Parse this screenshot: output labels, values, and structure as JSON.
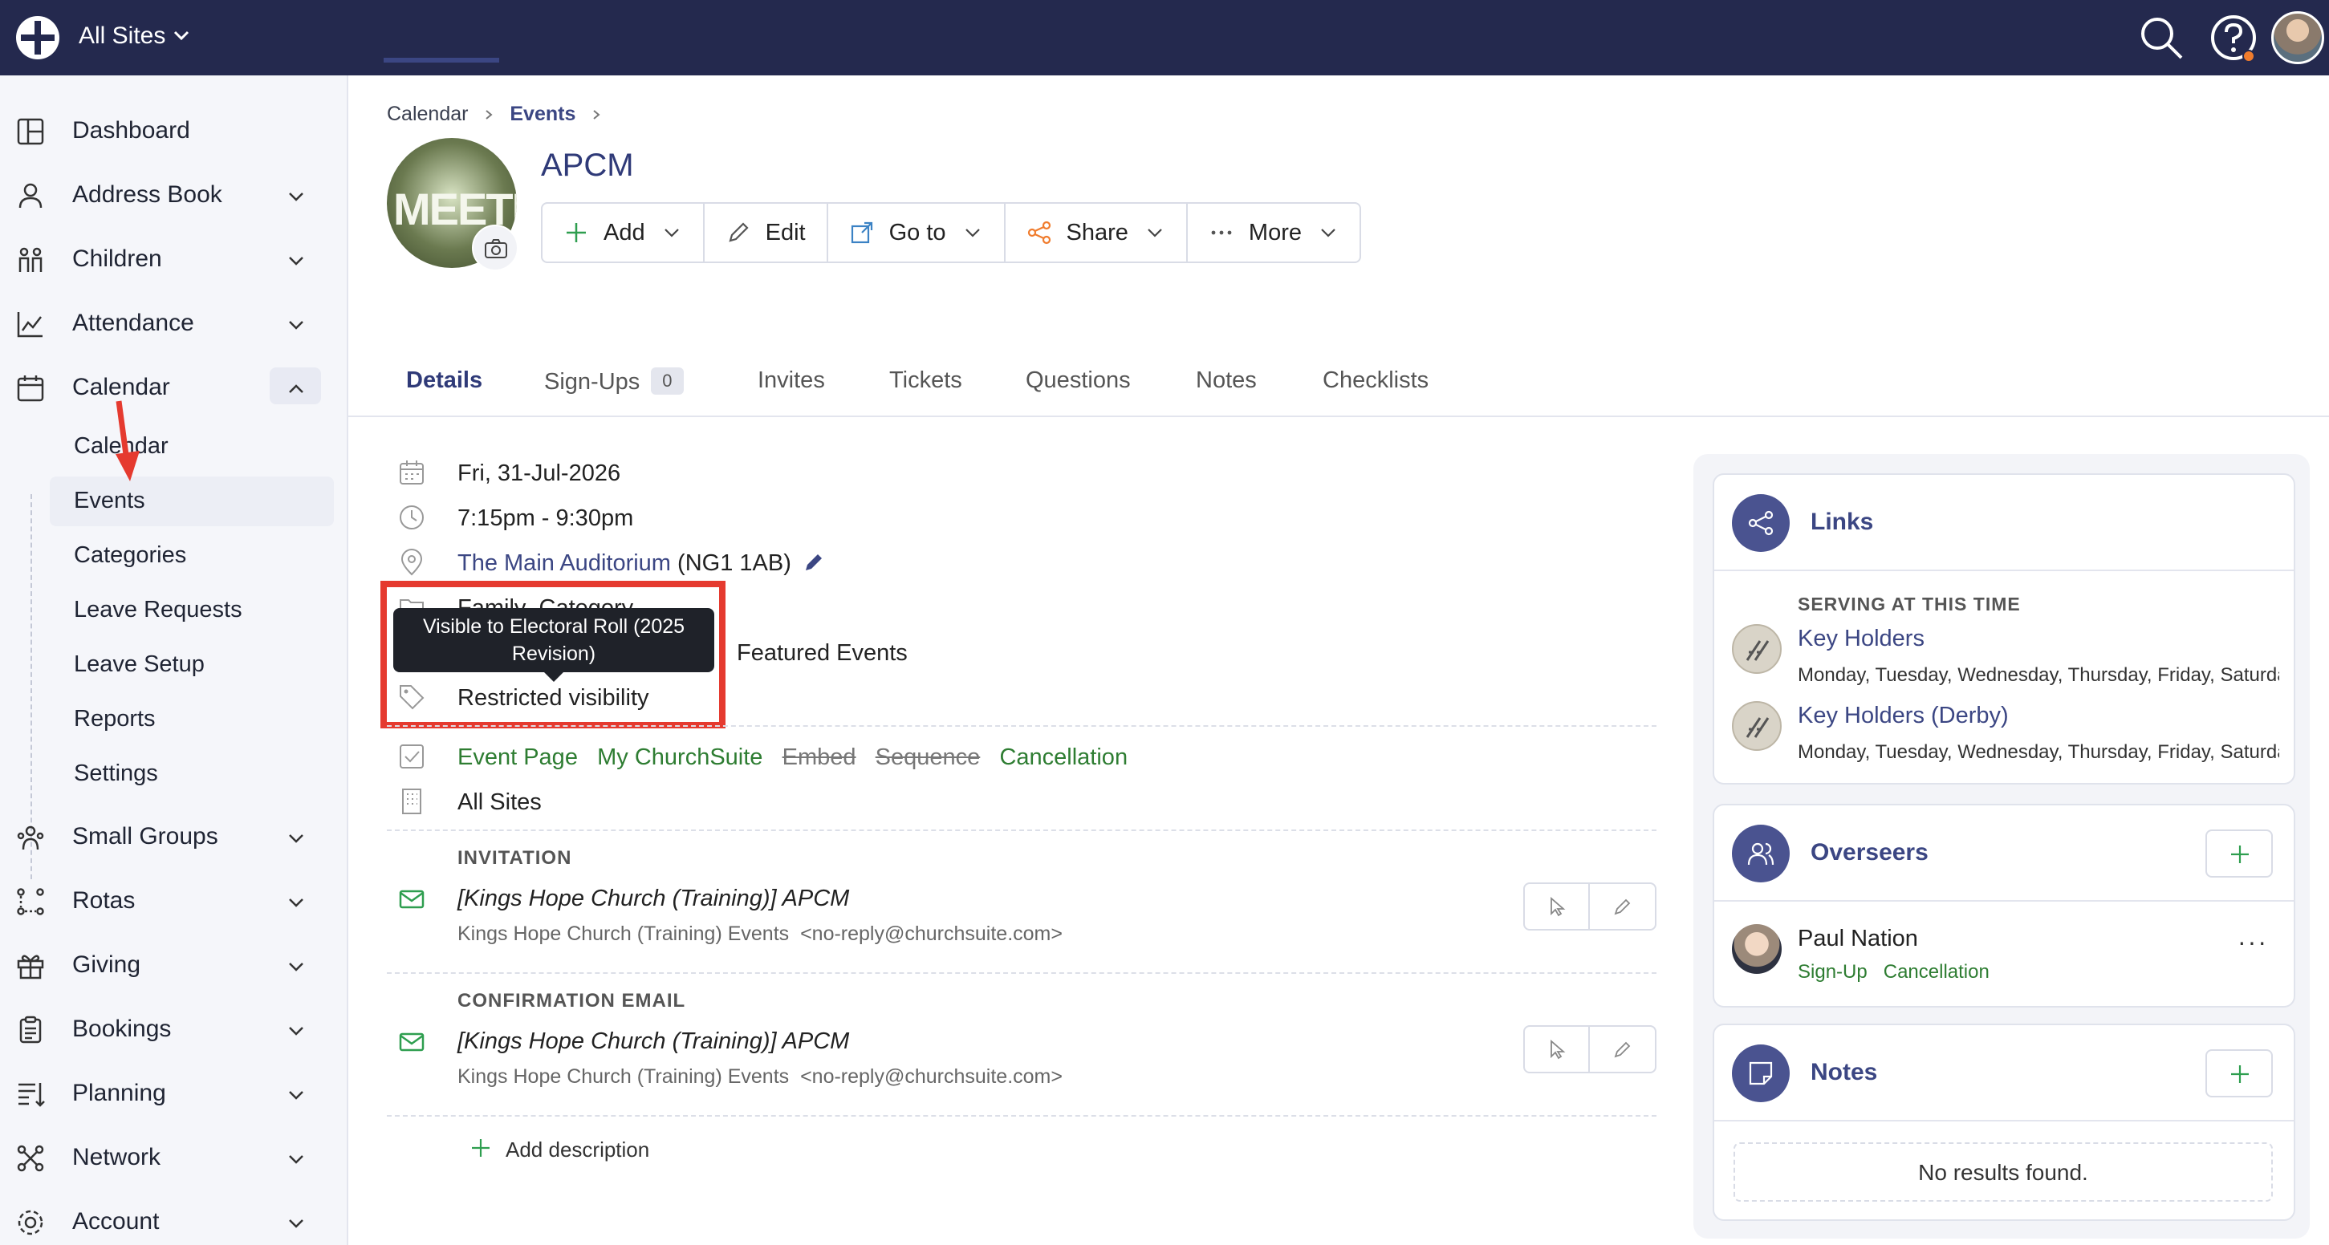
{
  "topbar": {
    "site_selector": "All Sites"
  },
  "sidebar": {
    "items": [
      {
        "label": "Dashboard",
        "icon": "dashboard-icon"
      },
      {
        "label": "Address Book",
        "icon": "person-icon"
      },
      {
        "label": "Children",
        "icon": "children-icon"
      },
      {
        "label": "Attendance",
        "icon": "chart-icon"
      },
      {
        "label": "Calendar",
        "icon": "calendar-icon"
      },
      {
        "label": "Small Groups",
        "icon": "groups-icon"
      },
      {
        "label": "Rotas",
        "icon": "rotas-icon"
      },
      {
        "label": "Giving",
        "icon": "gift-icon"
      },
      {
        "label": "Bookings",
        "icon": "clipboard-icon"
      },
      {
        "label": "Planning",
        "icon": "planning-icon"
      },
      {
        "label": "Network",
        "icon": "network-icon"
      },
      {
        "label": "Account",
        "icon": "gear-icon"
      }
    ],
    "calendar_sub": [
      "Calendar",
      "Events",
      "Categories",
      "Leave Requests",
      "Leave Setup",
      "Reports",
      "Settings"
    ]
  },
  "breadcrumb": {
    "root": "Calendar",
    "current": "Events"
  },
  "event": {
    "title": "APCM",
    "avatar_text": "MEETING"
  },
  "toolbar": {
    "add": "Add",
    "edit": "Edit",
    "goto": "Go to",
    "share": "Share",
    "more": "More"
  },
  "tabs": {
    "details": "Details",
    "signups": "Sign-Ups",
    "signups_count": "0",
    "invites": "Invites",
    "tickets": "Tickets",
    "questions": "Questions",
    "notes": "Notes",
    "checklists": "Checklists"
  },
  "details": {
    "date": "Fri, 31-Jul-2026",
    "time": "7:15pm - 9:30pm",
    "location_name": "The Main Auditorium",
    "location_postcode": "(NG1 1AB)",
    "category_partial": "Family",
    "category_label": "Category",
    "featured": "Featured Events",
    "visibility": "Restricted visibility",
    "tooltip": "Visible to Electoral Roll (2025 Revision)",
    "features": {
      "event_page": "Event Page",
      "my_churchsuite": "My ChurchSuite",
      "embed": "Embed",
      "sequence": "Sequence",
      "cancellation": "Cancellation"
    },
    "sites": "All Sites"
  },
  "invitation": {
    "heading": "INVITATION",
    "subject": "[Kings Hope Church (Training)] APCM",
    "from_name": "Kings Hope Church (Training) Events",
    "from_email": "<no-reply@churchsuite.com>"
  },
  "confirmation": {
    "heading": "CONFIRMATION EMAIL",
    "subject": "[Kings Hope Church (Training)] APCM",
    "from_name": "Kings Hope Church (Training) Events",
    "from_email": "<no-reply@churchsuite.com>"
  },
  "add_description": "Add description",
  "links_card": {
    "title": "Links",
    "serving_heading": "SERVING AT THIS TIME",
    "items": [
      {
        "name": "Key Holders",
        "days": "Monday, Tuesday, Wednesday, Thursday, Friday, Saturday"
      },
      {
        "name": "Key Holders (Derby)",
        "days": "Monday, Tuesday, Wednesday, Thursday, Friday, Saturday"
      }
    ]
  },
  "overseers_card": {
    "title": "Overseers",
    "person": "Paul Nation",
    "link1": "Sign-Up",
    "link2": "Cancellation",
    "more": "···"
  },
  "notes_card": {
    "title": "Notes",
    "empty": "No results found."
  },
  "colors": {
    "topbar": "#24294e",
    "accent": "#3b4683",
    "green": "#2e7d32",
    "red": "#c62828",
    "annotation": "#e53a2f"
  }
}
